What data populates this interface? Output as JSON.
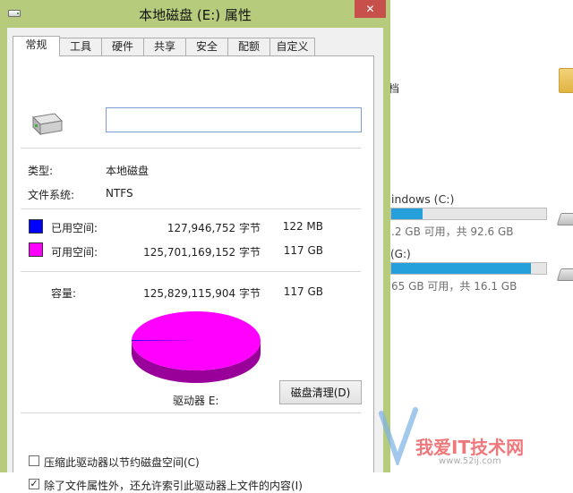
{
  "background_window": {
    "docs_fragment": "档",
    "drive_c": {
      "name": "indows (C:)",
      "status": ".2 GB 可用，共 92.6 GB",
      "used_fraction": 0.2
    },
    "drive_g": {
      "name": "(G:)",
      "status": "65 GB 可用，共 16.1 GB",
      "used_fraction": 0.9
    }
  },
  "dialog": {
    "title": "本地磁盘 (E:) 属性",
    "close_symbol": "✕",
    "tabs": [
      "常规",
      "工具",
      "硬件",
      "共享",
      "安全",
      "配额",
      "自定义"
    ],
    "active_tab": 0,
    "volume_label_value": "",
    "type_label": "类型:",
    "type_value": "本地磁盘",
    "fs_label": "文件系统:",
    "fs_value": "NTFS",
    "used": {
      "label": "已用空间:",
      "bytes": "127,946,752 字节",
      "size": "122 MB",
      "color": "#0000ff"
    },
    "free": {
      "label": "可用空间:",
      "bytes": "125,701,169,152 字节",
      "size": "117 GB",
      "color": "#ff00ff"
    },
    "capacity": {
      "label": "容量:",
      "bytes": "125,829,115,904 字节",
      "size": "117 GB"
    },
    "pie_used_fraction": 0.001,
    "drive_label": "驱动器 E:",
    "cleanup_button": "磁盘清理(D)",
    "compress_option": {
      "label": "压缩此驱动器以节约磁盘空间(C)",
      "checked": false
    },
    "index_option": {
      "label": "除了文件属性外，还允许索引此驱动器上文件的内容(I)",
      "checked": true
    }
  },
  "watermark": {
    "brand": "我爱IT技术网",
    "url": "www.52ij.com"
  }
}
